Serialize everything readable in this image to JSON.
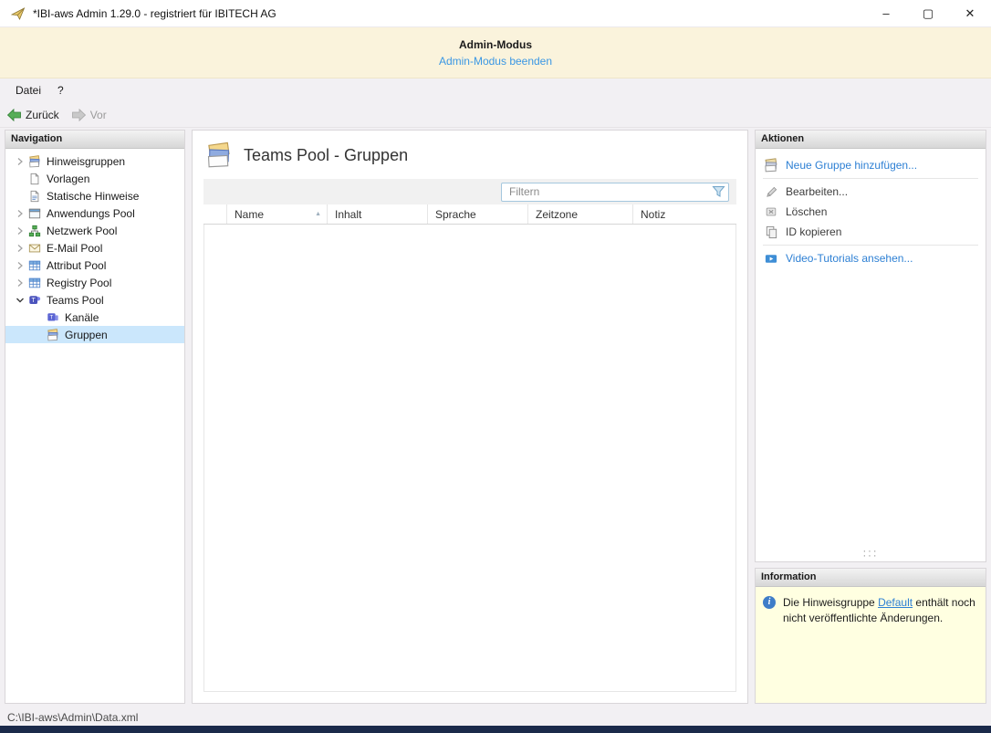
{
  "colors": {
    "accent_link": "#2E80D4",
    "banner_link": "#3A97E4",
    "selection_bg": "#CBE7FC",
    "info_bg": "#FFFFE1",
    "banner_bg": "#FAF3DC"
  },
  "window": {
    "title": "*IBI-aws Admin 1.29.0 - registriert für IBITECH AG",
    "minimize": "–",
    "maximize": "▢",
    "close": "✕"
  },
  "banner": {
    "title": "Admin-Modus",
    "link": "Admin-Modus beenden"
  },
  "menu": {
    "file": "Datei",
    "help": "?"
  },
  "toolbar": {
    "back": "Zurück",
    "forward": "Vor"
  },
  "navigation": {
    "header": "Navigation",
    "items": [
      {
        "label": "Hinweisgruppen",
        "expandable": true
      },
      {
        "label": "Vorlagen"
      },
      {
        "label": "Statische Hinweise"
      },
      {
        "label": "Anwendungs Pool",
        "expandable": true
      },
      {
        "label": "Netzwerk Pool",
        "expandable": true
      },
      {
        "label": "E-Mail Pool",
        "expandable": true
      },
      {
        "label": "Attribut Pool",
        "expandable": true
      },
      {
        "label": "Registry Pool",
        "expandable": true
      },
      {
        "label": "Teams Pool",
        "expandable": true,
        "expanded": true
      },
      {
        "label": "Kanäle",
        "child": true
      },
      {
        "label": "Gruppen",
        "child": true,
        "selected": true
      }
    ]
  },
  "main": {
    "title": "Teams Pool - Gruppen",
    "filter": {
      "placeholder": "Filtern"
    },
    "table": {
      "columns": [
        "Name",
        "Inhalt",
        "Sprache",
        "Zeitzone",
        "Notiz"
      ],
      "sorted_column": "Name",
      "sort_direction": "asc",
      "rows": []
    }
  },
  "actions": {
    "header": "Aktionen",
    "items": [
      {
        "label": "Neue Gruppe hinzufügen...",
        "type": "link"
      },
      {
        "label": "Bearbeiten...",
        "type": "disabled"
      },
      {
        "label": "Löschen",
        "type": "disabled"
      },
      {
        "label": "ID kopieren",
        "type": "disabled"
      },
      {
        "label": "Video-Tutorials ansehen...",
        "type": "link"
      }
    ]
  },
  "information": {
    "header": "Information",
    "text_before": "Die Hinweisgruppe ",
    "link": "Default",
    "text_after": " enthält noch nicht veröffentlichte Änderungen."
  },
  "statusbar": {
    "path": "C:\\IBI-aws\\Admin\\Data.xml"
  }
}
